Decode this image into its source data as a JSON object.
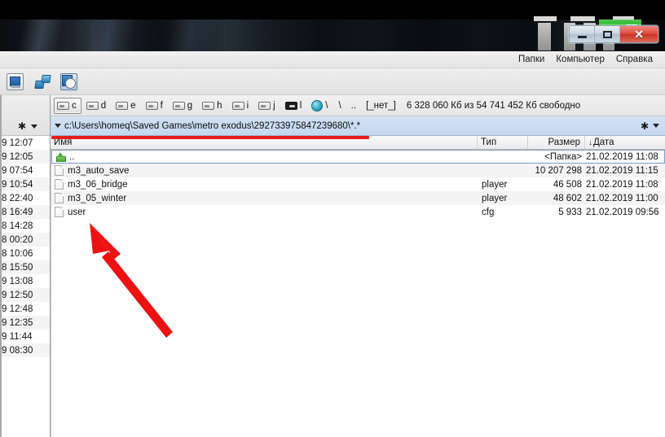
{
  "window": {
    "controls": {
      "minimize_label": "–",
      "maximize_label": "□",
      "close_label": "✕"
    }
  },
  "menubar": {
    "items": [
      {
        "label": "Папки"
      },
      {
        "label": "Компьютер"
      },
      {
        "label": "Справка"
      }
    ]
  },
  "toolbar": {
    "buttons": [
      {
        "icon": "lister-viewer-icon"
      },
      {
        "icon": "network-connect-icon"
      },
      {
        "icon": "synchronize-dirs-icon"
      }
    ]
  },
  "drivebar": {
    "drives": [
      {
        "letter": "c",
        "selected": true
      },
      {
        "letter": "d",
        "selected": false
      },
      {
        "letter": "e",
        "selected": false
      },
      {
        "letter": "f",
        "selected": false
      },
      {
        "letter": "g",
        "selected": false
      },
      {
        "letter": "h",
        "selected": false
      },
      {
        "letter": "i",
        "selected": false
      },
      {
        "letter": "j",
        "selected": false
      }
    ],
    "network_drive": {
      "letter": "l"
    },
    "root_sep_1": "\\",
    "root_sep_2": "\\",
    "parent_dir": "..",
    "volume_label": "[_нет_]",
    "free_space": "6 328 060 Кб из 54 741 452 Кб свободно"
  },
  "pathbar": {
    "path": "c:\\Users\\homeq\\Saved Games\\metro exodus\\292733975847239680\\*.*",
    "left_control_icon": "asterisk-icon",
    "right_control_icon": "asterisk-icon",
    "dropdown_icon": "chevron-down-icon"
  },
  "columns": {
    "name": "Имя",
    "type": "Тип",
    "size": "Размер",
    "date": "Дата",
    "sort_indicator": "↓"
  },
  "files": [
    {
      "icon": "up-folder-icon",
      "name": "..",
      "type": "",
      "size": "<Папка>",
      "date": "21.02.2019 11:08",
      "selected": true
    },
    {
      "icon": "file-icon",
      "name": "m3_auto_save",
      "type": "",
      "size": "10 207 298",
      "date": "21.02.2019 11:15",
      "selected": false
    },
    {
      "icon": "file-icon",
      "name": "m3_06_bridge",
      "type": "player",
      "size": "46 508",
      "date": "21.02.2019 11:08",
      "selected": false
    },
    {
      "icon": "file-icon",
      "name": "m3_05_winter",
      "type": "player",
      "size": "48 602",
      "date": "21.02.2019 11:00",
      "selected": false
    },
    {
      "icon": "file-icon",
      "name": "user",
      "type": "cfg",
      "size": "5 933",
      "date": "21.02.2019 09:56",
      "selected": false
    }
  ],
  "background_panel": {
    "rows": [
      {
        "text": "9 12:07"
      },
      {
        "text": "9 12:05"
      },
      {
        "text": "9 07:54"
      },
      {
        "text": "9 10:54"
      },
      {
        "text": "8 22:40"
      },
      {
        "text": "8 16:49"
      },
      {
        "text": "8 14:28"
      },
      {
        "text": "8 00:20"
      },
      {
        "text": "8 10:06"
      },
      {
        "text": "8 15:50"
      },
      {
        "text": "9 13:08"
      },
      {
        "text": "9 12:50"
      },
      {
        "text": "9 12:48"
      },
      {
        "text": "9 12:35"
      },
      {
        "text": "9 11:44"
      },
      {
        "text": "9 08:30"
      }
    ]
  },
  "annotations": {
    "underline_color": "#e81b1b",
    "arrow_color": "#ee1111",
    "arrow_target": "user"
  }
}
